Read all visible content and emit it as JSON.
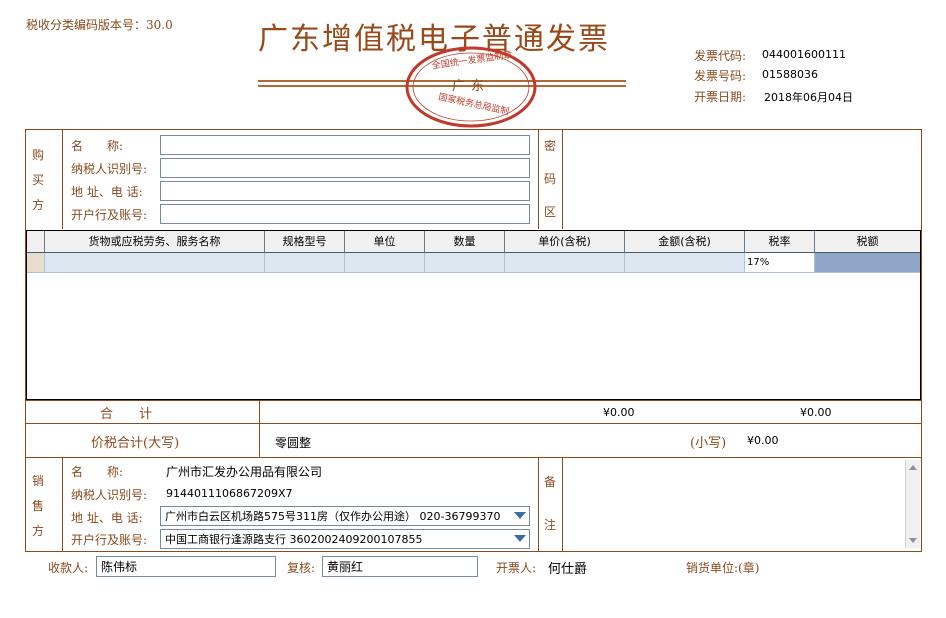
{
  "version_text": "税收分类编码版本号：30.0",
  "title": "广东增值税电子普通发票",
  "seal": {
    "top_text": "全国统一发票监制章",
    "center": "广东",
    "bottom_text": "国家税务总局监制"
  },
  "invoice_info": {
    "code_label": "发票代码:",
    "code": "044001600111",
    "number_label": "发票号码:",
    "number": "01588036",
    "date_label": "开票日期:",
    "date": "2018年06月04日"
  },
  "buyer": {
    "side": [
      "购",
      "买",
      "方"
    ],
    "name_label": "名　　称:",
    "name": "",
    "taxid_label": "纳税人识别号:",
    "taxid": "",
    "address_label": "地 址、电 话:",
    "address": "",
    "bank_label": "开户行及账号:",
    "bank": ""
  },
  "cipher_side": [
    "密",
    "码",
    "区"
  ],
  "table": {
    "headers": [
      "",
      "货物或应税劳务、服务名称",
      "规格型号",
      "单位",
      "数量",
      "单价(含税)",
      "金额(含税)",
      "税率",
      "税额"
    ],
    "rows": [
      [
        "",
        "",
        "",
        "",
        "",
        "",
        "",
        "17%",
        ""
      ]
    ]
  },
  "total": {
    "label": "合　　计",
    "amount": "¥0.00",
    "tax": "¥0.00"
  },
  "grand_total": {
    "label": "价税合计(大写)",
    "words": "零圆整",
    "small_label": "(小写)",
    "small_value": "¥0.00"
  },
  "seller": {
    "side": [
      "销",
      "售",
      "方"
    ],
    "name_label": "名　　称:",
    "name": "广州市汇发办公用品有限公司",
    "taxid_label": "纳税人识别号:",
    "taxid": "914401110686720​9X7",
    "address_label": "地 址、电 话:",
    "address": "广州市白云区机场路575号311房（仅作办公用途） 020-36799370",
    "bank_label": "开户行及账号:",
    "bank": "中国工商银行逢源路支行  3602002409200107855"
  },
  "remarks_side": [
    "备",
    "注"
  ],
  "footer": {
    "payee_label": "收款人:",
    "payee": "陈伟标",
    "reviewer_label": "复核:",
    "reviewer": "黄丽红",
    "drawer_label": "开票人:",
    "drawer": "何仕爵",
    "seller_label": "销货单位:(章)"
  },
  "colors": {
    "brown": "#8a4b1f",
    "seal_red": "#c0392b",
    "grid_row": "#dce7f2",
    "tax_cell": "#8fa5c7"
  }
}
